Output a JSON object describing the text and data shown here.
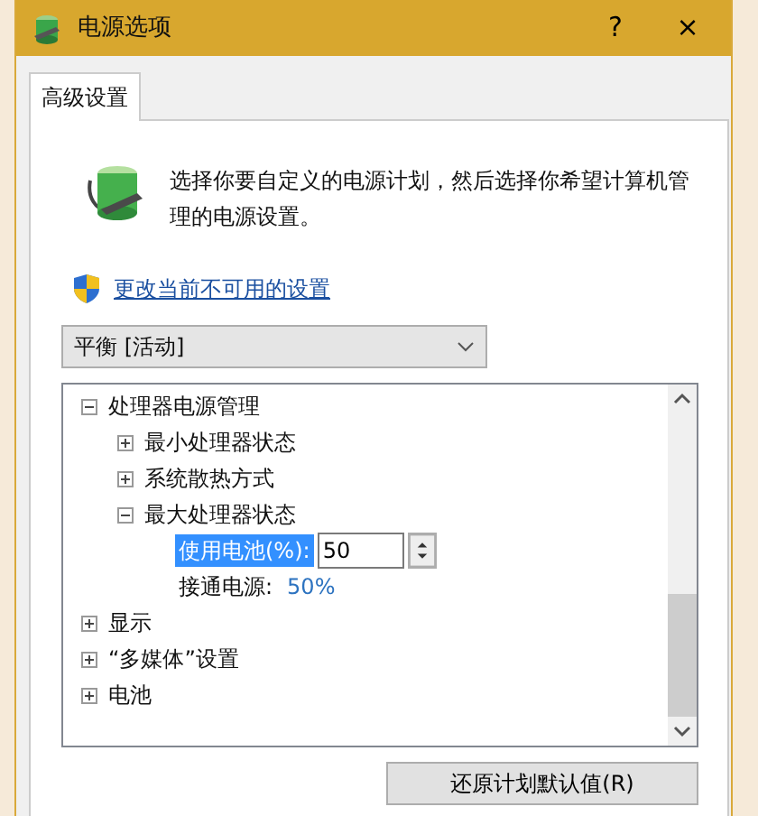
{
  "window": {
    "title": "电源选项",
    "help": "?",
    "close": "×"
  },
  "tabs": [
    {
      "label": "高级设置",
      "selected": true
    }
  ],
  "description": "选择你要自定义的电源计划，然后选择你希望计算机管理的电源设置。",
  "change_link": "更改当前不可用的设置",
  "plan_select": {
    "value": "平衡 [活动]"
  },
  "tree": [
    {
      "label": "处理器电源管理",
      "expanded": true,
      "children": [
        {
          "label": "最小处理器状态",
          "expanded": false
        },
        {
          "label": "系统散热方式",
          "expanded": false
        },
        {
          "label": "最大处理器状态",
          "expanded": true,
          "children": [
            {
              "kind": "spin",
              "label": "使用电池(%):",
              "value": "50",
              "selected": true
            },
            {
              "kind": "value",
              "label": "接通电源:",
              "value": "50%",
              "selected": false
            }
          ]
        }
      ]
    },
    {
      "label": "显示",
      "expanded": false
    },
    {
      "label": "“多媒体”设置",
      "expanded": false
    },
    {
      "label": "电池",
      "expanded": false
    }
  ],
  "restore_button": "还原计划默认值(R)"
}
